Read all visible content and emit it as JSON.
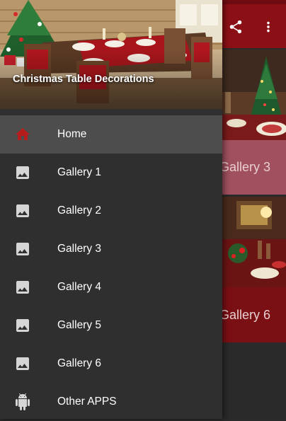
{
  "app": {
    "toolbar": {
      "share_icon": "share-icon",
      "more_icon": "more-vert-icon"
    },
    "cards": [
      {
        "caption": "Gallery 3"
      },
      {
        "caption": "Gallery 6"
      }
    ]
  },
  "drawer": {
    "header_title": "Christmas Table Decorations",
    "items": [
      {
        "label": "Home",
        "icon": "home-icon",
        "selected": true
      },
      {
        "label": "Gallery 1",
        "icon": "image-icon"
      },
      {
        "label": "Gallery 2",
        "icon": "image-icon"
      },
      {
        "label": "Gallery 3",
        "icon": "image-icon"
      },
      {
        "label": "Gallery 4",
        "icon": "image-icon"
      },
      {
        "label": "Gallery 5",
        "icon": "image-icon"
      },
      {
        "label": "Gallery 6",
        "icon": "image-icon"
      },
      {
        "label": "Other APPS",
        "icon": "android-icon"
      }
    ]
  },
  "colors": {
    "appbar": "#8b1016",
    "drawer_bg": "#2f2f2f",
    "selected_row": "#4d4d4d",
    "home_icon": "#b71c1c",
    "card_caption_bg_1": "#a0505e",
    "card_caption_bg_2": "#7a0f14"
  }
}
